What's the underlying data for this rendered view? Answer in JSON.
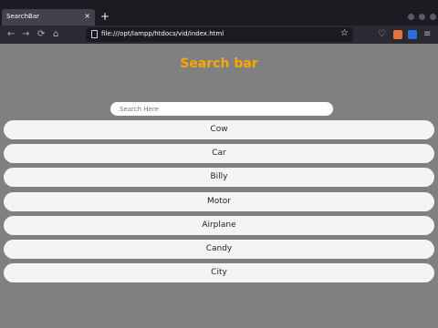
{
  "browser": {
    "tab_title": "SearchBar",
    "tab_close": "×",
    "new_tab": "+",
    "url": "file:///opt/lampp/htdocs/vid/index.html",
    "nav": {
      "back": "←",
      "forward": "→",
      "reload": "⟳",
      "home": "⌂",
      "bookmark_star": "☆",
      "menu": "≡"
    },
    "extension_colors": [
      "#e8703a",
      "#2a6be0"
    ]
  },
  "page": {
    "title": "Search bar",
    "title_color": "#ffa500",
    "background": "#808080",
    "search": {
      "placeholder": "Search Here",
      "value": ""
    },
    "items": [
      "Cow",
      "Car",
      "Billy",
      "Motor",
      "Airplane",
      "Candy",
      "City"
    ]
  }
}
